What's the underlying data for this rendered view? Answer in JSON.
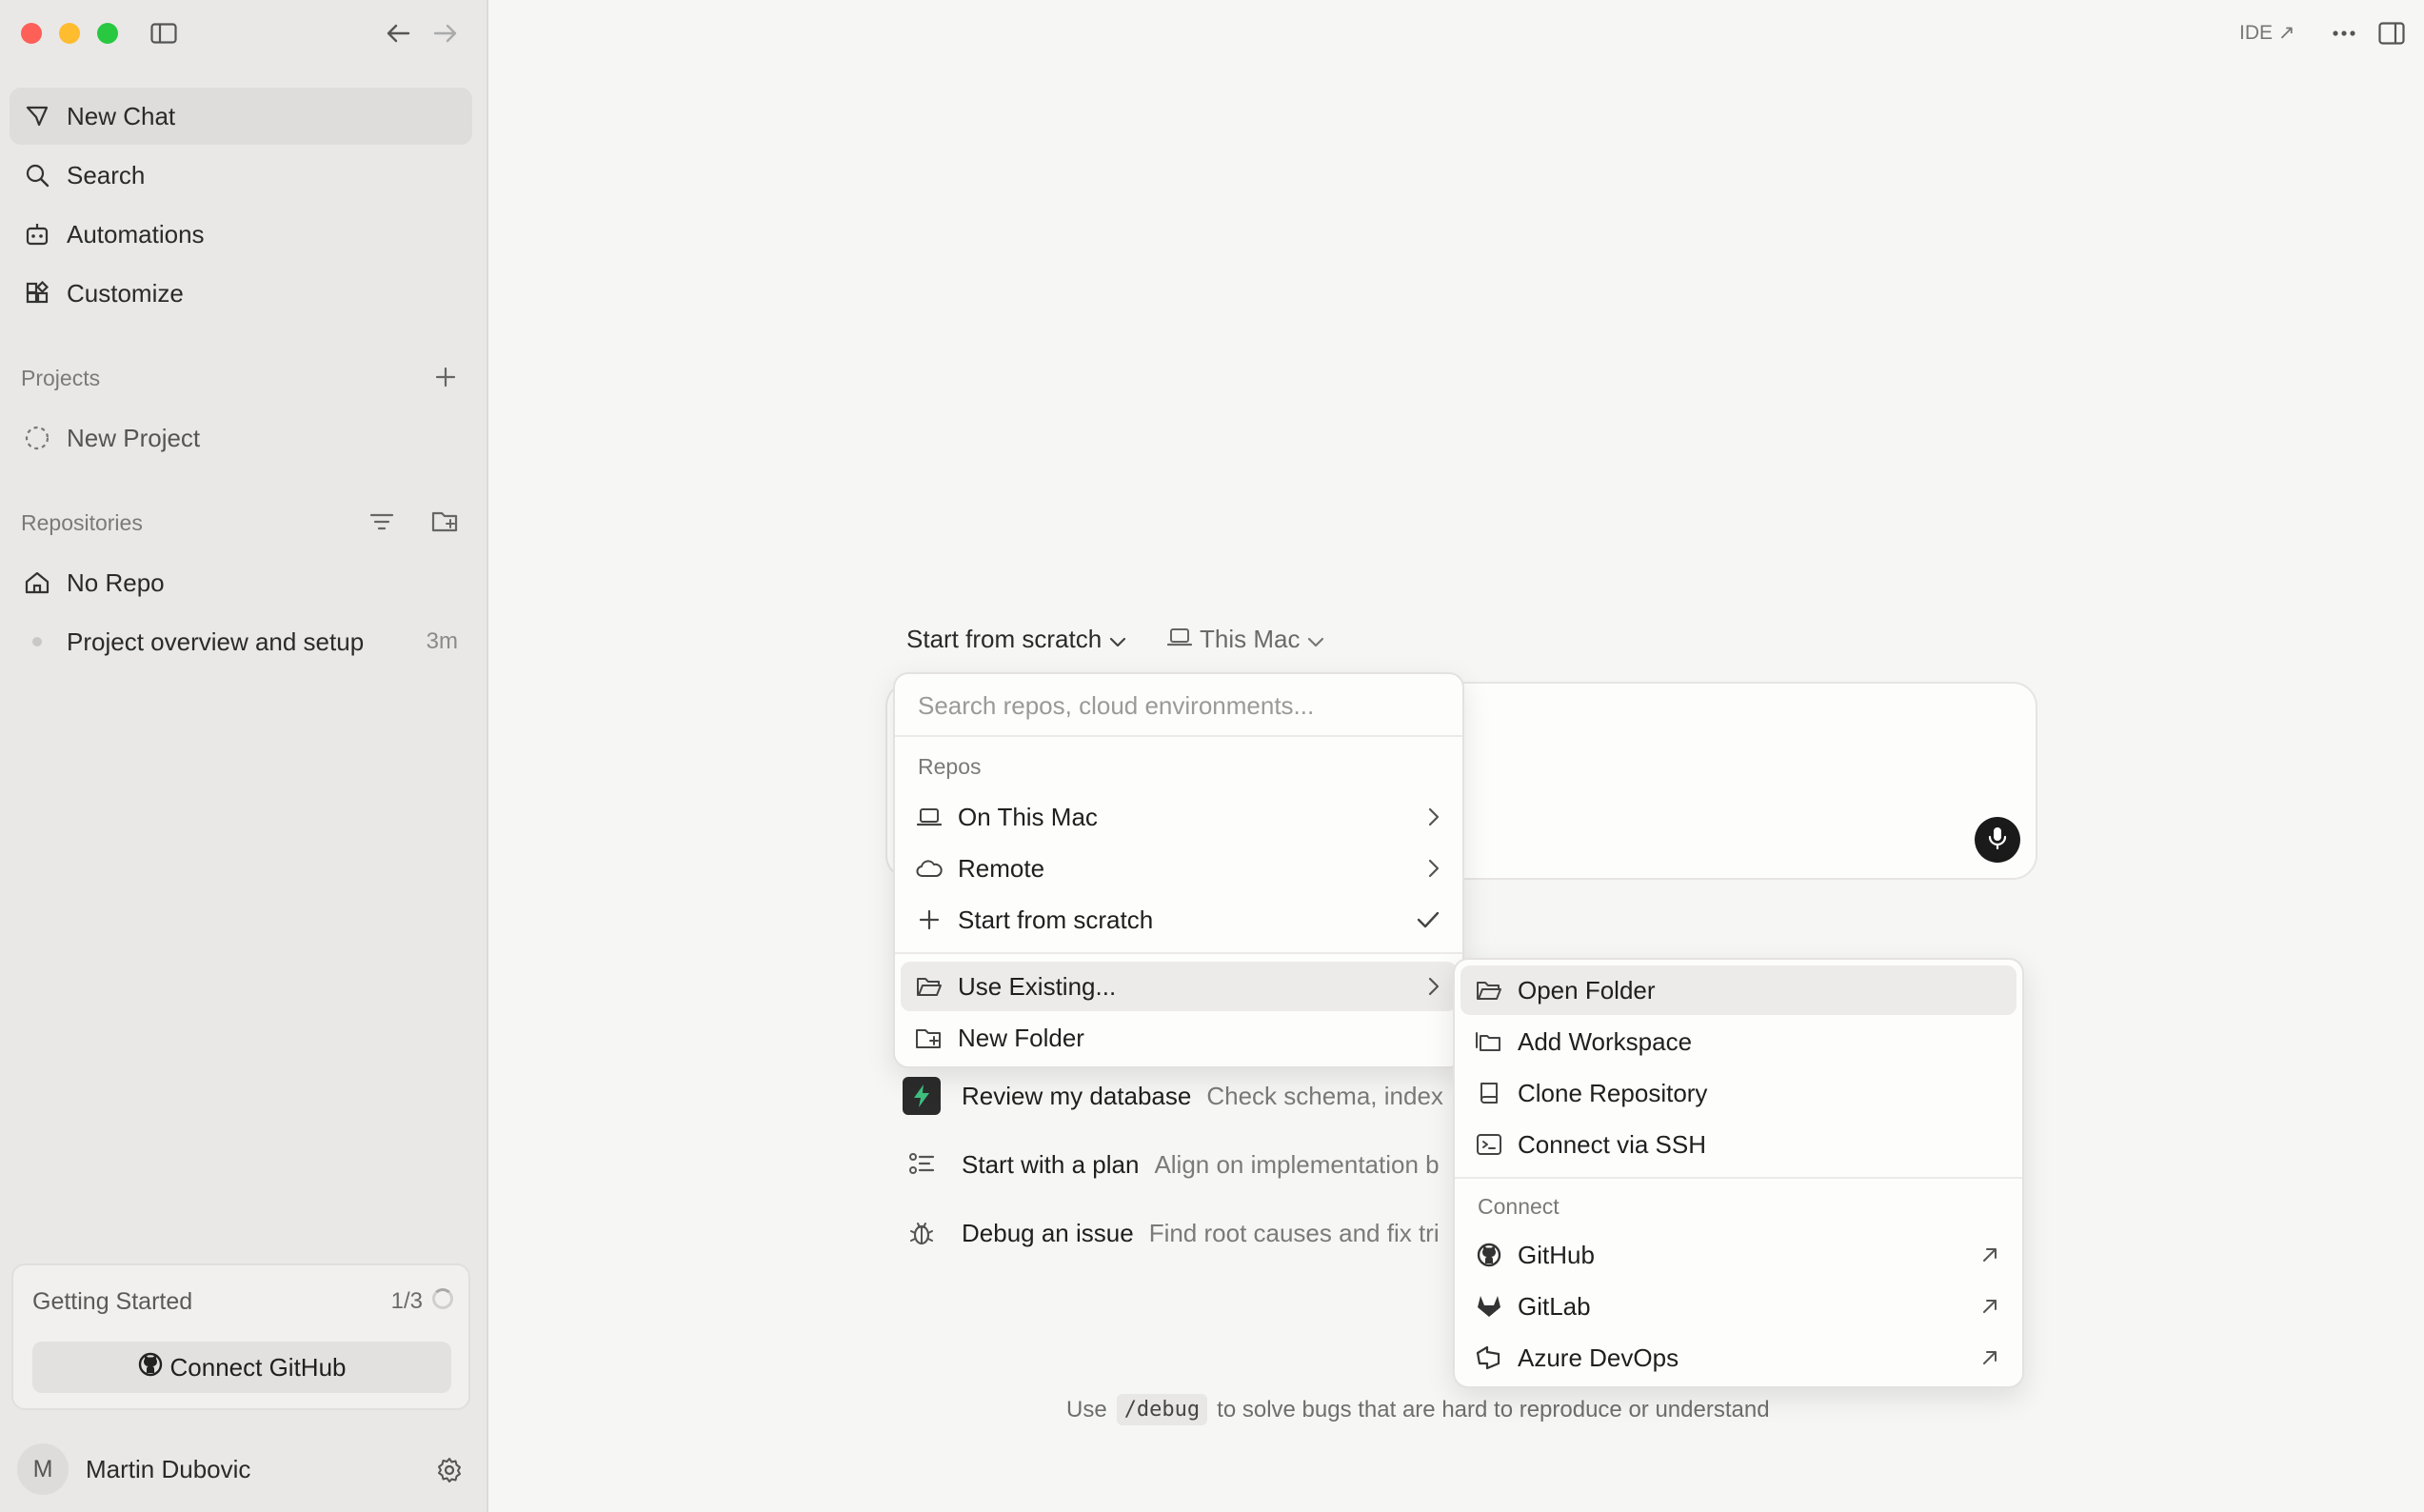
{
  "sidebar": {
    "nav": [
      {
        "label": "New Chat",
        "icon": "compose-icon"
      },
      {
        "label": "Search",
        "icon": "search-icon"
      },
      {
        "label": "Automations",
        "icon": "robot-icon"
      },
      {
        "label": "Customize",
        "icon": "blocks-icon"
      }
    ],
    "projects": {
      "title": "Projects",
      "items": [
        {
          "label": "New Project"
        }
      ]
    },
    "repositories": {
      "title": "Repositories",
      "items": [
        {
          "label": "No Repo"
        }
      ],
      "recent": {
        "label": "Project overview and setup",
        "time": "3m"
      }
    },
    "getting_started": {
      "title": "Getting Started",
      "count": "1/3",
      "button": "Connect GitHub"
    },
    "user": {
      "initial": "M",
      "name": "Martin Dubovic"
    }
  },
  "topbar": {
    "ide_label": "IDE ↗"
  },
  "composer": {
    "source_selector": "Start from scratch",
    "location_selector": "This Mac"
  },
  "source_menu": {
    "search_placeholder": "Search repos, cloud environments...",
    "section": "Repos",
    "items": [
      {
        "label": "On This Mac"
      },
      {
        "label": "Remote"
      },
      {
        "label": "Start from scratch"
      },
      {
        "label": "Use Existing..."
      },
      {
        "label": "New Folder"
      }
    ]
  },
  "existing_menu": {
    "items": [
      {
        "label": "Open Folder"
      },
      {
        "label": "Add Workspace"
      },
      {
        "label": "Clone Repository"
      },
      {
        "label": "Connect via SSH"
      }
    ],
    "connect_heading": "Connect",
    "connect": [
      {
        "label": "GitHub"
      },
      {
        "label": "GitLab"
      },
      {
        "label": "Azure DevOps"
      }
    ]
  },
  "suggestions": [
    {
      "title": "Review my database",
      "desc": "Check schema, index"
    },
    {
      "title": "Start with a plan",
      "desc": "Align on implementation b"
    },
    {
      "title": "Debug an issue",
      "desc": "Find root causes and fix tri"
    }
  ],
  "hint": {
    "prefix": "Use",
    "command": "/debug",
    "suffix": "to solve bugs that are hard to reproduce or understand"
  },
  "colors": {
    "accent_green": "#3fbf7f",
    "mic_bg": "#1a1a1a",
    "sidebar_bg": "#e9e8e7"
  }
}
